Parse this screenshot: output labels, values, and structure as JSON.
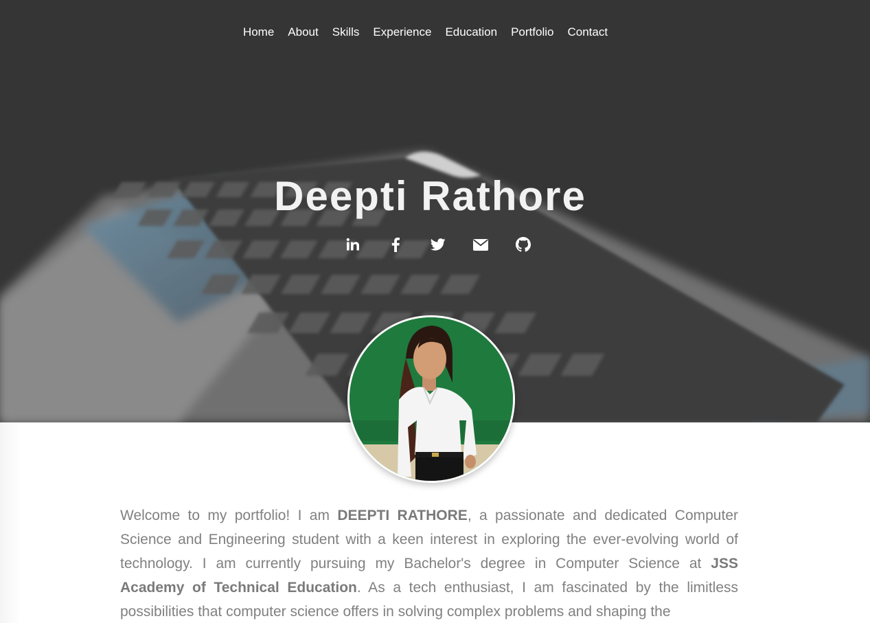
{
  "nav": {
    "items": [
      {
        "label": "Home"
      },
      {
        "label": "About"
      },
      {
        "label": "Skills"
      },
      {
        "label": "Experience"
      },
      {
        "label": "Education"
      },
      {
        "label": "Portfolio"
      },
      {
        "label": "Contact"
      }
    ]
  },
  "hero": {
    "name": "Deepti Rathore",
    "background_color": "#353535"
  },
  "social": [
    {
      "icon": "linkedin-icon"
    },
    {
      "icon": "facebook-icon"
    },
    {
      "icon": "twitter-icon"
    },
    {
      "icon": "envelope-icon"
    },
    {
      "icon": "github-icon"
    }
  ],
  "about": {
    "intro": "Welcome to my portfolio! I am ",
    "name_bold": "DEEPTI RATHORE",
    "text_1": ", a passionate and dedicated Computer Science and Engineering student with a keen interest in exploring the ever-evolving world of technology. I am currently pursuing my Bachelor's degree in Computer Science at ",
    "college_bold": "JSS Academy of Technical Education",
    "text_2": ". As a tech enthusiast, I am fascinated by the limitless possibilities that computer science offers in solving complex problems and shaping the"
  },
  "colors": {
    "text_muted": "#808080",
    "nav_text": "#ffffff",
    "avatar_bg": "#1f7a3e"
  }
}
